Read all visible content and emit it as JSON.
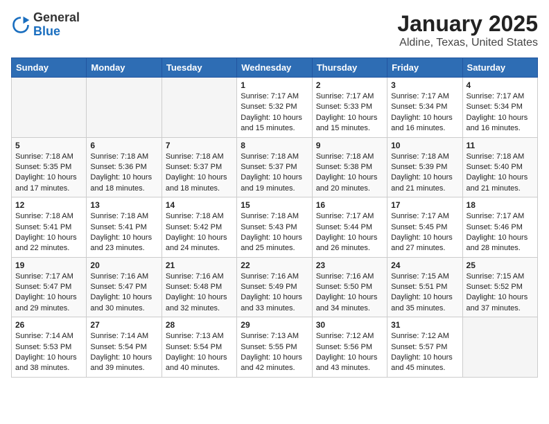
{
  "header": {
    "logo_general": "General",
    "logo_blue": "Blue",
    "title": "January 2025",
    "subtitle": "Aldine, Texas, United States"
  },
  "days_of_week": [
    "Sunday",
    "Monday",
    "Tuesday",
    "Wednesday",
    "Thursday",
    "Friday",
    "Saturday"
  ],
  "weeks": [
    [
      {
        "day": "",
        "info": ""
      },
      {
        "day": "",
        "info": ""
      },
      {
        "day": "",
        "info": ""
      },
      {
        "day": "1",
        "info": "Sunrise: 7:17 AM\nSunset: 5:32 PM\nDaylight: 10 hours\nand 15 minutes."
      },
      {
        "day": "2",
        "info": "Sunrise: 7:17 AM\nSunset: 5:33 PM\nDaylight: 10 hours\nand 15 minutes."
      },
      {
        "day": "3",
        "info": "Sunrise: 7:17 AM\nSunset: 5:34 PM\nDaylight: 10 hours\nand 16 minutes."
      },
      {
        "day": "4",
        "info": "Sunrise: 7:17 AM\nSunset: 5:34 PM\nDaylight: 10 hours\nand 16 minutes."
      }
    ],
    [
      {
        "day": "5",
        "info": "Sunrise: 7:18 AM\nSunset: 5:35 PM\nDaylight: 10 hours\nand 17 minutes."
      },
      {
        "day": "6",
        "info": "Sunrise: 7:18 AM\nSunset: 5:36 PM\nDaylight: 10 hours\nand 18 minutes."
      },
      {
        "day": "7",
        "info": "Sunrise: 7:18 AM\nSunset: 5:37 PM\nDaylight: 10 hours\nand 18 minutes."
      },
      {
        "day": "8",
        "info": "Sunrise: 7:18 AM\nSunset: 5:37 PM\nDaylight: 10 hours\nand 19 minutes."
      },
      {
        "day": "9",
        "info": "Sunrise: 7:18 AM\nSunset: 5:38 PM\nDaylight: 10 hours\nand 20 minutes."
      },
      {
        "day": "10",
        "info": "Sunrise: 7:18 AM\nSunset: 5:39 PM\nDaylight: 10 hours\nand 21 minutes."
      },
      {
        "day": "11",
        "info": "Sunrise: 7:18 AM\nSunset: 5:40 PM\nDaylight: 10 hours\nand 21 minutes."
      }
    ],
    [
      {
        "day": "12",
        "info": "Sunrise: 7:18 AM\nSunset: 5:41 PM\nDaylight: 10 hours\nand 22 minutes."
      },
      {
        "day": "13",
        "info": "Sunrise: 7:18 AM\nSunset: 5:41 PM\nDaylight: 10 hours\nand 23 minutes."
      },
      {
        "day": "14",
        "info": "Sunrise: 7:18 AM\nSunset: 5:42 PM\nDaylight: 10 hours\nand 24 minutes."
      },
      {
        "day": "15",
        "info": "Sunrise: 7:18 AM\nSunset: 5:43 PM\nDaylight: 10 hours\nand 25 minutes."
      },
      {
        "day": "16",
        "info": "Sunrise: 7:17 AM\nSunset: 5:44 PM\nDaylight: 10 hours\nand 26 minutes."
      },
      {
        "day": "17",
        "info": "Sunrise: 7:17 AM\nSunset: 5:45 PM\nDaylight: 10 hours\nand 27 minutes."
      },
      {
        "day": "18",
        "info": "Sunrise: 7:17 AM\nSunset: 5:46 PM\nDaylight: 10 hours\nand 28 minutes."
      }
    ],
    [
      {
        "day": "19",
        "info": "Sunrise: 7:17 AM\nSunset: 5:47 PM\nDaylight: 10 hours\nand 29 minutes."
      },
      {
        "day": "20",
        "info": "Sunrise: 7:16 AM\nSunset: 5:47 PM\nDaylight: 10 hours\nand 30 minutes."
      },
      {
        "day": "21",
        "info": "Sunrise: 7:16 AM\nSunset: 5:48 PM\nDaylight: 10 hours\nand 32 minutes."
      },
      {
        "day": "22",
        "info": "Sunrise: 7:16 AM\nSunset: 5:49 PM\nDaylight: 10 hours\nand 33 minutes."
      },
      {
        "day": "23",
        "info": "Sunrise: 7:16 AM\nSunset: 5:50 PM\nDaylight: 10 hours\nand 34 minutes."
      },
      {
        "day": "24",
        "info": "Sunrise: 7:15 AM\nSunset: 5:51 PM\nDaylight: 10 hours\nand 35 minutes."
      },
      {
        "day": "25",
        "info": "Sunrise: 7:15 AM\nSunset: 5:52 PM\nDaylight: 10 hours\nand 37 minutes."
      }
    ],
    [
      {
        "day": "26",
        "info": "Sunrise: 7:14 AM\nSunset: 5:53 PM\nDaylight: 10 hours\nand 38 minutes."
      },
      {
        "day": "27",
        "info": "Sunrise: 7:14 AM\nSunset: 5:54 PM\nDaylight: 10 hours\nand 39 minutes."
      },
      {
        "day": "28",
        "info": "Sunrise: 7:13 AM\nSunset: 5:54 PM\nDaylight: 10 hours\nand 40 minutes."
      },
      {
        "day": "29",
        "info": "Sunrise: 7:13 AM\nSunset: 5:55 PM\nDaylight: 10 hours\nand 42 minutes."
      },
      {
        "day": "30",
        "info": "Sunrise: 7:12 AM\nSunset: 5:56 PM\nDaylight: 10 hours\nand 43 minutes."
      },
      {
        "day": "31",
        "info": "Sunrise: 7:12 AM\nSunset: 5:57 PM\nDaylight: 10 hours\nand 45 minutes."
      },
      {
        "day": "",
        "info": ""
      }
    ]
  ]
}
